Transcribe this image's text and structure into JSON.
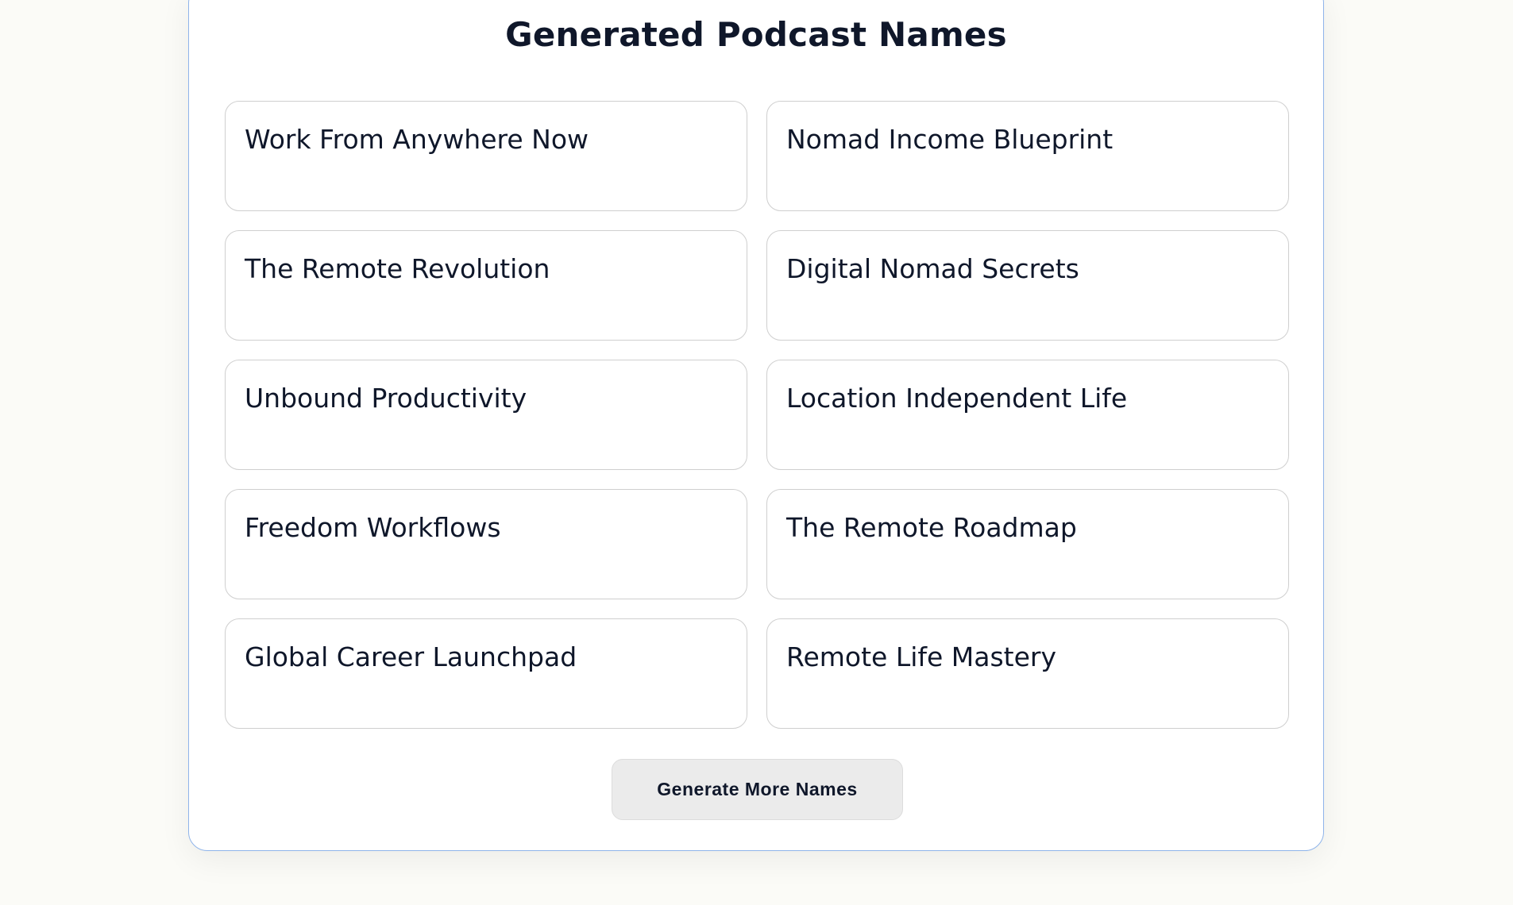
{
  "section": {
    "title": "Generated Podcast Names"
  },
  "names": [
    "Work From Anywhere Now",
    "Nomad Income Blueprint",
    "The Remote Revolution",
    "Digital Nomad Secrets",
    "Unbound Productivity",
    "Location Independent Life",
    "Freedom Workflows",
    "The Remote Roadmap",
    "Global Career Launchpad",
    "Remote Life Mastery"
  ],
  "actions": {
    "generate_more_label": "Generate More Names"
  },
  "colors": {
    "background": "#fbfbf7",
    "card_border": "#8fb4ea",
    "text": "#0f172a",
    "button_bg": "#ebebeb"
  }
}
